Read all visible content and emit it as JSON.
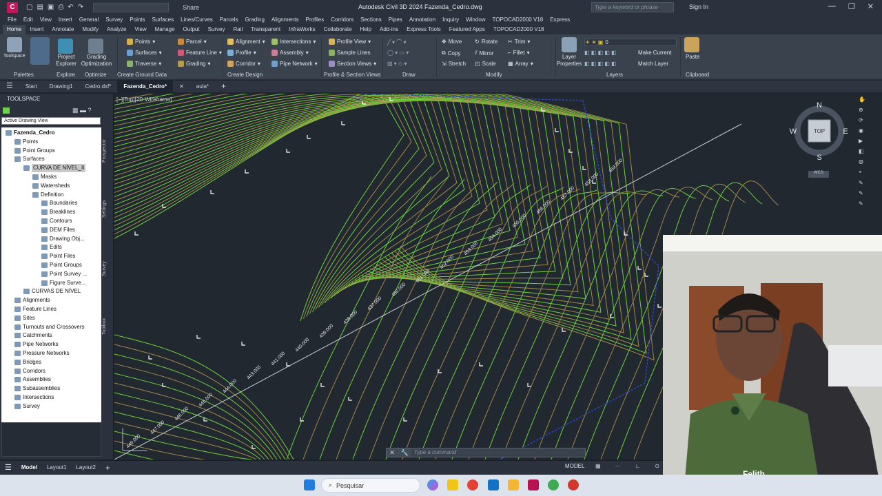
{
  "titlebar": {
    "app_title": "Autodesk Civil 3D 2024   Fazenda_Cedro.dwg",
    "share": "Share",
    "search_placeholder": "Type a keyword or phrase",
    "sign_in": "Sign In"
  },
  "menu": [
    "File",
    "Edit",
    "View",
    "Insert",
    "General",
    "Survey",
    "Points",
    "Surfaces",
    "Lines/Curves",
    "Parcels",
    "Grading",
    "Alignments",
    "Profiles",
    "Corridors",
    "Sections",
    "Pipes",
    "Annotation",
    "Inquiry",
    "Window",
    "TOPOCAD2000 V18",
    "Express"
  ],
  "ribbon_tabs": [
    "Home",
    "Insert",
    "Annotate",
    "Modify",
    "Analyze",
    "View",
    "Manage",
    "Output",
    "Survey",
    "Rail",
    "Transparent",
    "InfraWorks",
    "Collaborate",
    "Help",
    "Add-ins",
    "Express Tools",
    "Featured Apps",
    "TOPOCAD2000 V18"
  ],
  "ribbon": {
    "toolspace": "Toolspace",
    "project_explorer": "Project Explorer",
    "grading_optimization": "Grading Optimization",
    "points": "Points",
    "surfaces": "Surfaces",
    "traverse": "Traverse",
    "parcel": "Parcel",
    "feature_line": "Feature Line",
    "grading": "Grading",
    "alignment": "Alignment",
    "profile": "Profile",
    "corridor": "Corridor",
    "intersections": "Intersections",
    "assembly": "Assembly",
    "pipe_network": "Pipe Network",
    "profile_view": "Profile View",
    "sample_lines": "Sample Lines",
    "section_views": "Section Views",
    "move": "Move",
    "rotate": "Rotate",
    "trim": "Trim",
    "copy": "Copy",
    "mirror": "Mirror",
    "fillet": "Fillet",
    "stretch": "Stretch",
    "scale": "Scale",
    "array": "Array",
    "layer_properties": "Layer Properties",
    "layer_value": "0",
    "make_current": "Make Current",
    "match_layer": "Match Layer",
    "paste": "Paste",
    "groups": [
      "Palettes",
      "Explore",
      "Optimize",
      "Create Ground Data",
      "Create Design",
      "Profile & Section Views",
      "Draw",
      "Modify",
      "Layers",
      "Clipboard"
    ]
  },
  "doc_tabs": [
    "Start",
    "Drawing1",
    "Cedro.dxf*",
    "Fazenda_Cedro*",
    "aula*"
  ],
  "toolspace": {
    "title": "TOOLSPACE",
    "dropdown": "Active Drawing View",
    "side_tabs": [
      "Prospector",
      "Settings",
      "Survey",
      "Toolbox"
    ],
    "tree": [
      {
        "label": "Fazenda_Cedro",
        "level": 0,
        "bold": true
      },
      {
        "label": "Points",
        "level": 1
      },
      {
        "label": "Point Groups",
        "level": 1
      },
      {
        "label": "Surfaces",
        "level": 1
      },
      {
        "label": "CURVA DE NÍVEL_II",
        "level": 2,
        "selected": true
      },
      {
        "label": "Masks",
        "level": 3
      },
      {
        "label": "Watersheds",
        "level": 3
      },
      {
        "label": "Definition",
        "level": 3
      },
      {
        "label": "Boundaries",
        "level": 4
      },
      {
        "label": "Breaklines",
        "level": 4
      },
      {
        "label": "Contours",
        "level": 4
      },
      {
        "label": "DEM Files",
        "level": 4
      },
      {
        "label": "Drawing Obj...",
        "level": 4
      },
      {
        "label": "Edits",
        "level": 4
      },
      {
        "label": "Point Files",
        "level": 4
      },
      {
        "label": "Point Groups",
        "level": 4
      },
      {
        "label": "Point Survey ...",
        "level": 4
      },
      {
        "label": "Figure Surve...",
        "level": 4
      },
      {
        "label": "CURVAS DE NÍVEL",
        "level": 2
      },
      {
        "label": "Alignments",
        "level": 1
      },
      {
        "label": "Feature Lines",
        "level": 1
      },
      {
        "label": "Sites",
        "level": 1
      },
      {
        "label": "Turnouts and Crossovers",
        "level": 1
      },
      {
        "label": "Catchments",
        "level": 1
      },
      {
        "label": "Pipe Networks",
        "level": 1
      },
      {
        "label": "Pressure Networks",
        "level": 1
      },
      {
        "label": "Bridges",
        "level": 1
      },
      {
        "label": "Corridors",
        "level": 1
      },
      {
        "label": "Assemblies",
        "level": 1
      },
      {
        "label": "Subassemblies",
        "level": 1
      },
      {
        "label": "Intersections",
        "level": 1
      },
      {
        "label": "Survey",
        "level": 1
      }
    ]
  },
  "viewport": {
    "label": "[−][Top][2D Wireframe]",
    "navcube": {
      "n": "N",
      "s": "S",
      "e": "E",
      "w": "W",
      "top": "TOP",
      "wcs": "WCS"
    },
    "contour_labels": [
      "449.000",
      "447.000",
      "446.000",
      "445.000",
      "444.000",
      "443.000",
      "441.000",
      "440.000",
      "439.000",
      "438.000",
      "437.000",
      "450.000",
      "451.000",
      "452.000",
      "453.000",
      "454.000",
      "455.000",
      "456.000",
      "457.000",
      "458.000",
      "459.000"
    ]
  },
  "command": {
    "placeholder": "Type a command"
  },
  "status": {
    "tabs": [
      "Model",
      "Layout1",
      "Layout2"
    ],
    "model_label": "MODEL"
  },
  "taskbar": {
    "search": "Pesquisar"
  },
  "webcam": {
    "watermark": "Felith"
  },
  "colors": {
    "contour_major": "#6ed23c",
    "contour_minor": "#a0894a",
    "boundary": "#2d46c8",
    "background": "#212830"
  }
}
